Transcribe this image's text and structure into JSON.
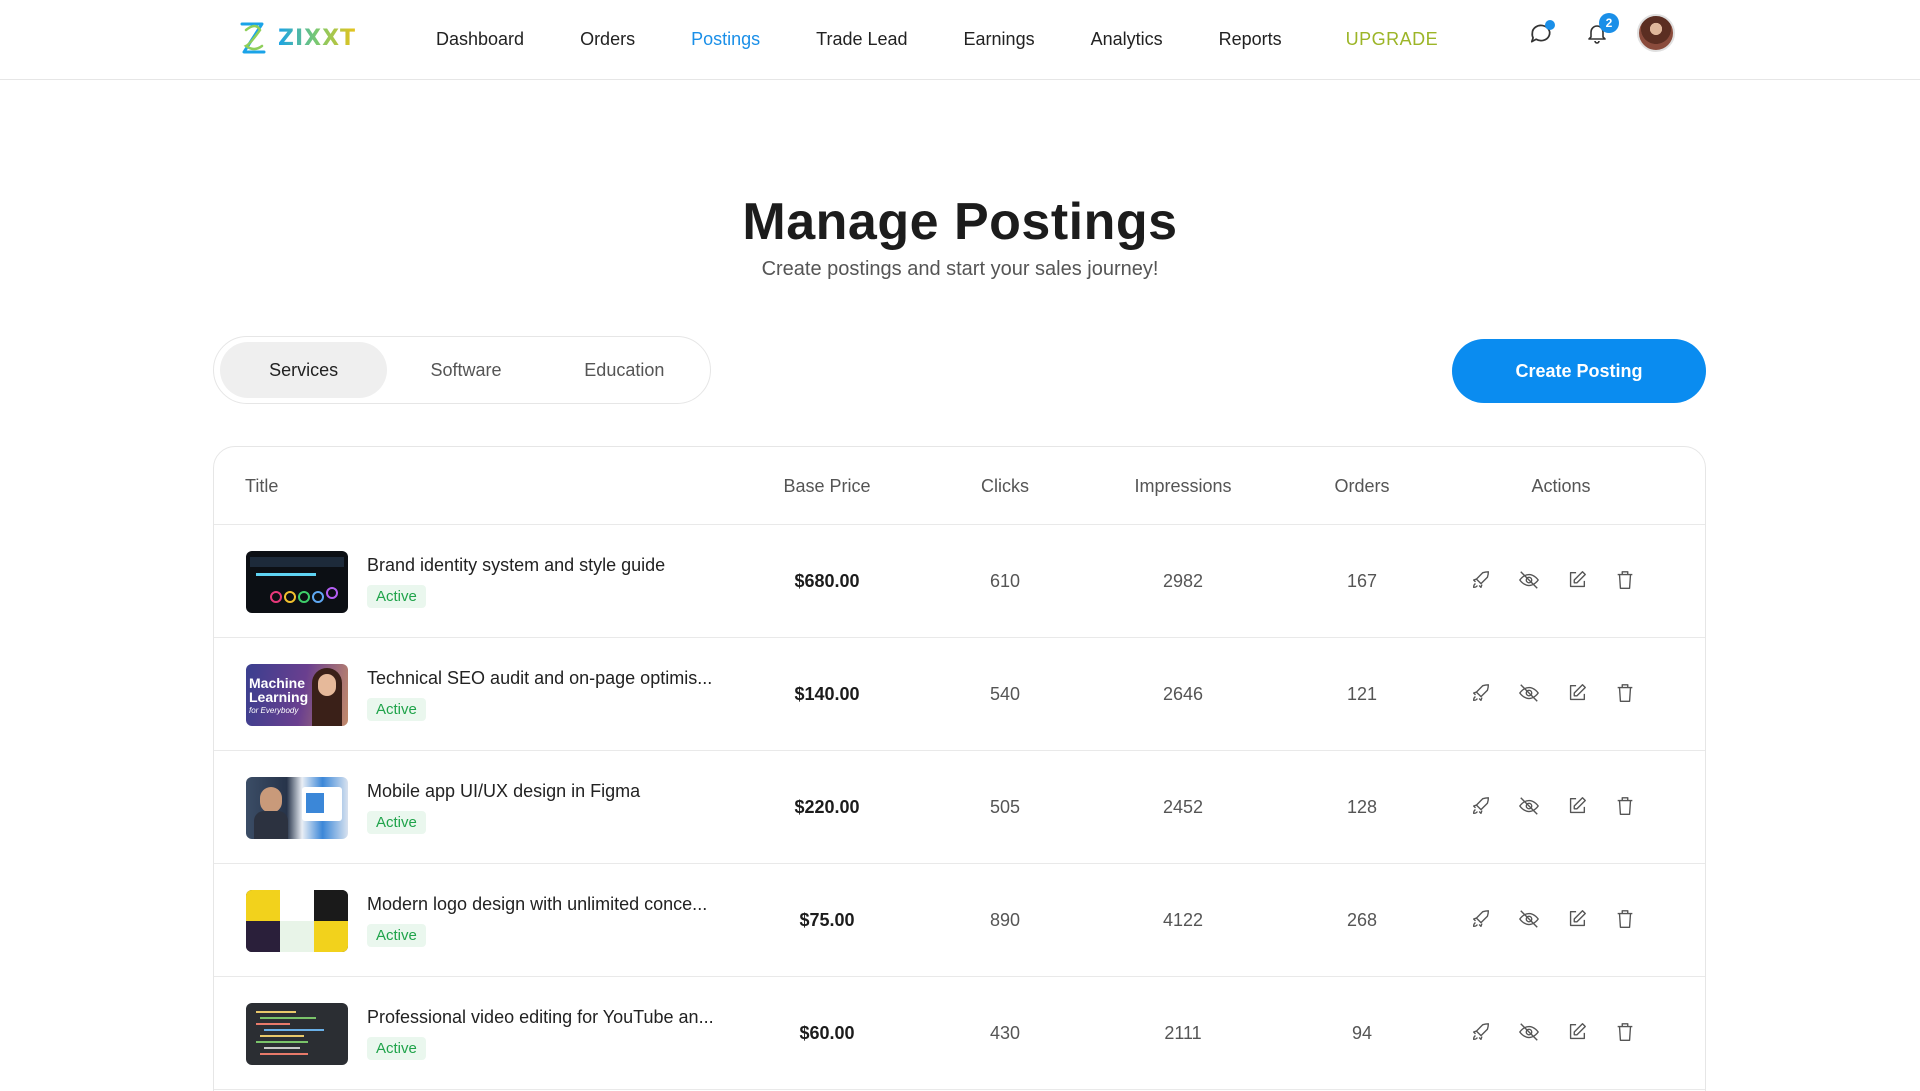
{
  "header": {
    "logo_text": "ZIXXT",
    "nav": [
      {
        "label": "Dashboard"
      },
      {
        "label": "Orders"
      },
      {
        "label": "Postings"
      },
      {
        "label": "Trade Lead"
      },
      {
        "label": "Earnings"
      },
      {
        "label": "Analytics"
      },
      {
        "label": "Reports"
      },
      {
        "label": "UPGRADE"
      }
    ],
    "active_nav": "Postings",
    "notification_count": "2",
    "accent_color": "#0a8cf0",
    "upgrade_color": "#9cb527"
  },
  "page": {
    "title": "Manage Postings",
    "subtitle": "Create postings and start your sales journey!"
  },
  "tabs": [
    {
      "label": "Services"
    },
    {
      "label": "Software"
    },
    {
      "label": "Education"
    }
  ],
  "selected_tab": "Services",
  "create_button": "Create Posting",
  "table": {
    "columns": {
      "title": "Title",
      "price": "Base Price",
      "clicks": "Clicks",
      "impressions": "Impressions",
      "orders": "Orders",
      "actions": "Actions"
    },
    "rows": [
      {
        "title": "Brand identity system and style guide",
        "status": "Active",
        "price": "$680.00",
        "clicks": "610",
        "impressions": "2982",
        "orders": "167"
      },
      {
        "title": "Technical SEO audit and on-page optimis...",
        "status": "Active",
        "price": "$140.00",
        "clicks": "540",
        "impressions": "2646",
        "orders": "121",
        "thumb_text_1": "Machine",
        "thumb_text_2": "Learning",
        "thumb_text_3": "for Everybody"
      },
      {
        "title": "Mobile app UI/UX design in Figma",
        "status": "Active",
        "price": "$220.00",
        "clicks": "505",
        "impressions": "2452",
        "orders": "128"
      },
      {
        "title": "Modern logo design with unlimited conce...",
        "status": "Active",
        "price": "$75.00",
        "clicks": "890",
        "impressions": "4122",
        "orders": "268"
      },
      {
        "title": "Professional video editing for YouTube an...",
        "status": "Active",
        "price": "$60.00",
        "clicks": "430",
        "impressions": "2111",
        "orders": "94"
      }
    ],
    "action_icons": [
      "rocket-icon",
      "eye-off-icon",
      "edit-icon",
      "trash-icon"
    ]
  }
}
